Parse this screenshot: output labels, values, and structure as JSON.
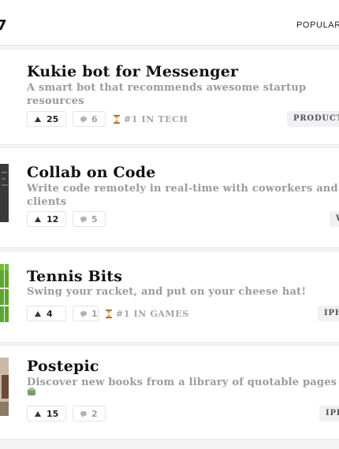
{
  "header": {
    "brand_fragment": "7",
    "sort_label": "POPULAR"
  },
  "posts": [
    {
      "title": "Kukie bot for Messenger",
      "tagline": "A smart bot that recommends awesome startup resources",
      "upvotes": "25",
      "comments": "6",
      "rank": "#1 IN TECH",
      "tag": "PRODUCTIV"
    },
    {
      "title": "Collab on Code",
      "tagline": "Write code remotely in real-time with coworkers and clients",
      "upvotes": "12",
      "comments": "5",
      "tag": "W"
    },
    {
      "title": "Tennis Bits",
      "tagline": "Swing your racket, and put on your cheese hat!",
      "upvotes": "4",
      "comments": "1",
      "rank": "#1 IN GAMES",
      "tag": "IPH"
    },
    {
      "title": "Postepic",
      "tagline": "Discover new books from a library of quotable pages",
      "upvotes": "15",
      "comments": "2",
      "tag": "IPH"
    }
  ],
  "colors": {
    "background": "#f4f4f5",
    "card": "#ffffff",
    "title": "#111111",
    "tagline": "#9a9aa0",
    "rank_text": "#a5a5aa",
    "tag_background": "#f1f1f3"
  }
}
